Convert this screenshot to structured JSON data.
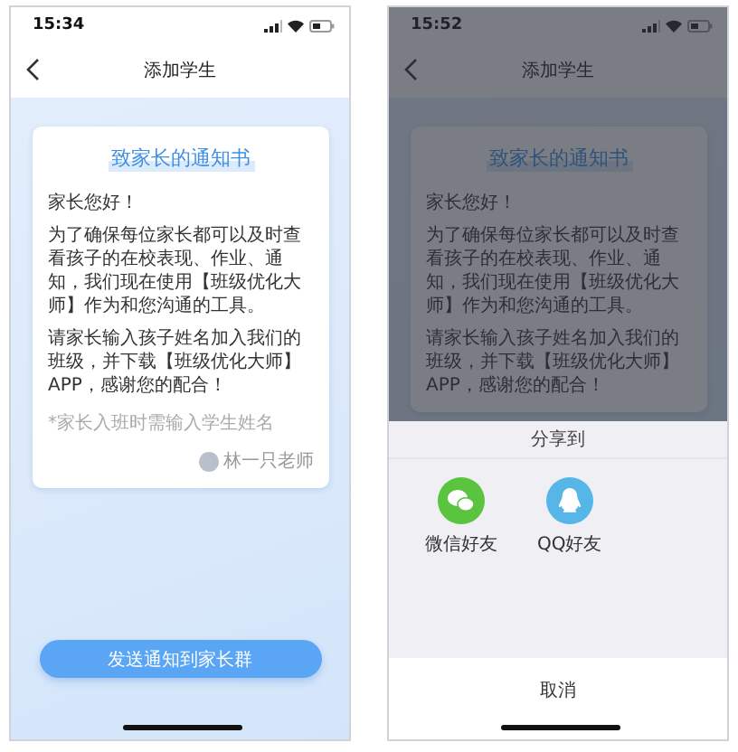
{
  "screens": [
    {
      "status_bar": {
        "time": "15:34"
      },
      "nav": {
        "title": "添加学生"
      },
      "letter": {
        "title": "致家长的通知书",
        "greeting": "家长您好！",
        "paragraphs": [
          "为了确保每位家长都可以及时查看孩子的在校表现、作业、通知，我们现在使用【班级优化大师】作为和您沟通的工具。",
          "请家长输入孩子姓名加入我们的班级，并下载【班级优化大师】APP，感谢您的配合！"
        ],
        "hint": "*家长入班时需输入学生姓名",
        "signature": "林一只老师"
      },
      "send_button": "发送通知到家长群"
    },
    {
      "status_bar": {
        "time": "15:52"
      },
      "nav": {
        "title": "添加学生"
      },
      "letter": {
        "title": "致家长的通知书",
        "greeting": "家长您好！",
        "paragraphs": [
          "为了确保每位家长都可以及时查看孩子的在校表现、作业、通知，我们现在使用【班级优化大师】作为和您沟通的工具。",
          "请家长输入孩子姓名加入我们的班级，并下载【班级优化大师】APP，感谢您的配合！"
        ]
      },
      "share_sheet": {
        "title": "分享到",
        "targets": [
          {
            "label": "微信好友",
            "kind": "wechat"
          },
          {
            "label": "QQ好友",
            "kind": "qq"
          }
        ],
        "cancel": "取消"
      }
    }
  ]
}
